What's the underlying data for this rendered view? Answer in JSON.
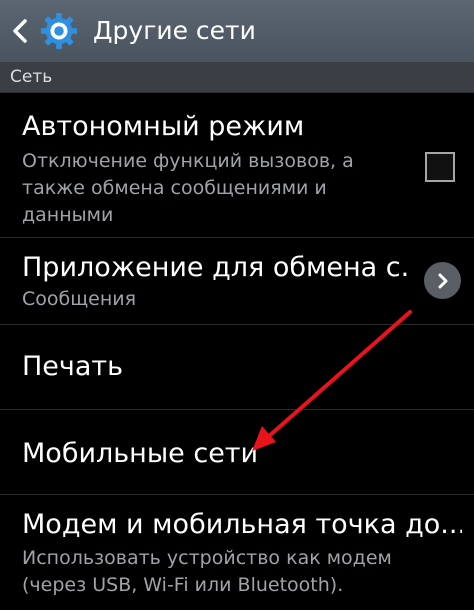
{
  "header": {
    "title": "Другие сети",
    "back_icon": "chevron-left-icon",
    "app_icon": "gear-icon",
    "color": "#56616c"
  },
  "section": {
    "label": "Сеть"
  },
  "items": [
    {
      "title": "Автономный режим",
      "subtitle_lines": [
        "Отключение функций вызовов, а",
        "также обмена сообщениями и",
        "данными"
      ],
      "control": "checkbox",
      "checked": false
    },
    {
      "title": "Приложение для обмена с...",
      "subtitle_lines": [
        "Сообщения"
      ],
      "control": "chevron-right-icon"
    },
    {
      "title": "Печать"
    },
    {
      "title": "Мобильные сети"
    },
    {
      "title": "Модем и мобильная точка до...",
      "subtitle_lines": [
        "Использовать устройство как модем",
        "(через USB, Wi-Fi или Bluetooth)."
      ]
    }
  ],
  "annotation": {
    "arrow_color": "#e8131b"
  }
}
